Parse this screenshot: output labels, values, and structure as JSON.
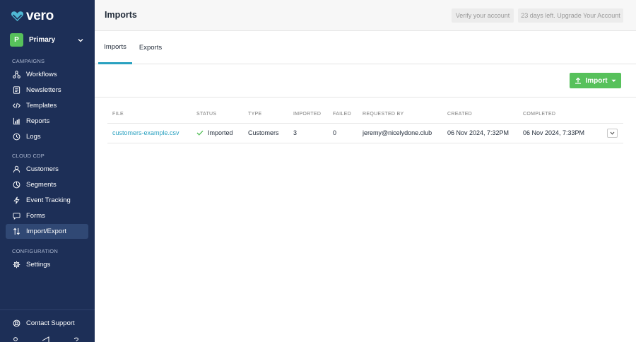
{
  "app": {
    "name": "vero"
  },
  "workspace": {
    "initial": "P",
    "name": "Primary"
  },
  "sidebar": {
    "sections": [
      {
        "label": "CAMPAIGNS"
      },
      {
        "label": "CLOUD CDP"
      },
      {
        "label": "CONFIGURATION"
      }
    ],
    "items": [
      {
        "label": "Workflows",
        "icon": "workflow-icon"
      },
      {
        "label": "Newsletters",
        "icon": "newsletter-icon"
      },
      {
        "label": "Templates",
        "icon": "code-icon"
      },
      {
        "label": "Reports",
        "icon": "chart-icon"
      },
      {
        "label": "Logs",
        "icon": "clock-icon"
      },
      {
        "label": "Customers",
        "icon": "user-icon"
      },
      {
        "label": "Segments",
        "icon": "pie-icon"
      },
      {
        "label": "Event Tracking",
        "icon": "lightning-icon"
      },
      {
        "label": "Forms",
        "icon": "chat-icon"
      },
      {
        "label": "Import/Export",
        "icon": "import-export-icon",
        "active": true
      },
      {
        "label": "Settings",
        "icon": "gear-icon"
      }
    ],
    "support": {
      "label": "Contact Support"
    }
  },
  "header": {
    "title": "Imports",
    "verify_label": "Verify your account",
    "trial_label": "23 days left. Upgrade Your Account"
  },
  "tabs": [
    {
      "label": "Imports",
      "active": true
    },
    {
      "label": "Exports"
    }
  ],
  "toolbar": {
    "import_label": "Import"
  },
  "table": {
    "columns": [
      "FILE",
      "STATUS",
      "TYPE",
      "IMPORTED",
      "FAILED",
      "REQUESTED BY",
      "CREATED",
      "COMPLETED"
    ],
    "rows": [
      {
        "file": "customers-example.csv",
        "status": "Imported",
        "type": "Customers",
        "imported": "3",
        "failed": "0",
        "requested_by": "jeremy@nicelydone.club",
        "created": "06 Nov 2024, 7:32PM",
        "completed": "06 Nov 2024, 7:33PM"
      }
    ]
  },
  "colors": {
    "sidebar_bg": "#1d2f57",
    "accent": "#2aa1c0",
    "success": "#57c15b"
  }
}
